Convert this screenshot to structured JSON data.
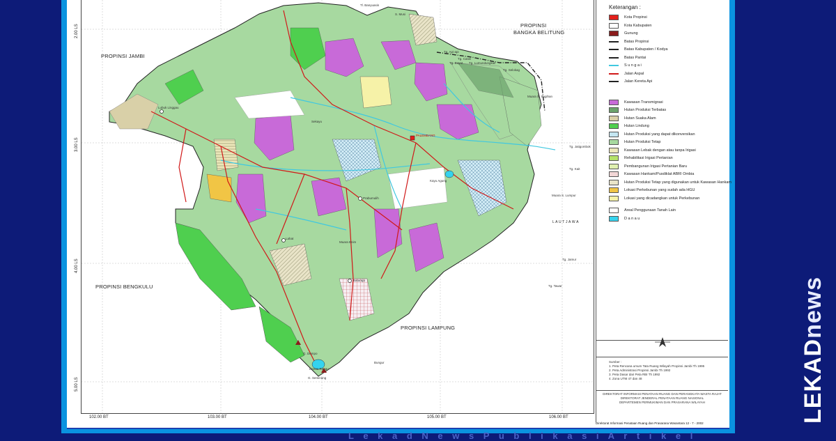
{
  "map": {
    "regions": {
      "jambi": "PROPINSI JAMBI",
      "bangka_1": "PROPINSI",
      "bangka_2": "BANGKA BELITUNG",
      "bengkulu": "PROPINSI BENGKULU",
      "lampung": "PROPINSI LAMPUNG",
      "laut_jawa": "L A U T   J A W A"
    },
    "lat_ticks": [
      "2.00 LS",
      "3.00 LS",
      "4.00 LS",
      "5.00 LS"
    ],
    "lon_ticks": [
      "102.00 BT",
      "103.00 BT",
      "104.00 BT",
      "105.00 BT",
      "106.00 BT"
    ],
    "places": {
      "p1": "Tg. Api-api",
      "p2": "Tg. Carat",
      "p3": "Tg. Buyut",
      "p4": "Tg. Lumundungkuli",
      "p5": "Tg. Selokag",
      "p6": "PALEMBANG",
      "p7": "Muara S. Sugihan",
      "p8": "Tg. Jatigombok",
      "p9": "Tg. Kait",
      "p10": "Muara S. Lumpur",
      "p11": "Tg. Jamur",
      "p12": "Tg. Tawar",
      "p13": "Kayu Agung",
      "p14": "Baturaja",
      "p15": "Bungur",
      "p16": "G. Dempo",
      "p17": "G. Seminung",
      "p18": "Sekayu",
      "p19": "Lahat",
      "p20": "Tl. Banyuasin",
      "p21": "Prabumulih",
      "p22": "Muara Enim",
      "p23": "Lubuk Linggau",
      "p24": "S. Musi",
      "p25": "Danau Ranau"
    }
  },
  "legend": {
    "title": "Keterangan :",
    "items": [
      {
        "label": "Kota Propinsi",
        "color": "#e3201b",
        "icon": "square-marker-icon"
      },
      {
        "label": "Kota Kabupaten",
        "color": "#ffffff",
        "icon": "circle-cross-icon"
      },
      {
        "label": "Gunung",
        "color": "#8b1c1c",
        "icon": "triangle-icon"
      },
      {
        "label": "Batas Propinsi",
        "color": "#222222",
        "icon": "dash-dot-line-icon"
      },
      {
        "label": "Batas Kabupaten / Kodya",
        "color": "#222222",
        "icon": "dash-line-icon"
      },
      {
        "label": "Batas Pantai",
        "color": "#222222",
        "icon": "solid-line-icon"
      },
      {
        "label": "S u n g a i",
        "color": "#40c8e0",
        "icon": "river-icon"
      },
      {
        "label": "Jalan Aspal",
        "color": "#d01818",
        "icon": "road-icon"
      },
      {
        "label": "Jalan Kereta Api",
        "color": "#222222",
        "icon": "railway-icon"
      },
      {
        "label": "Kawasan Transmigrasi",
        "color": "#c86ad8"
      },
      {
        "label": "Hutan Produksi Terbatas",
        "color": "#6ca36c"
      },
      {
        "label": "Hutan Suaka Alam",
        "color": "#d9d0a8"
      },
      {
        "label": "Hutan Lindung",
        "color": "#4fcf4f"
      },
      {
        "label": "Hutan Produksi yang dapat dikonversikan",
        "color": "#c4e6f2"
      },
      {
        "label": "Hutan Produksi Tetap",
        "color": "#a7d9a0"
      },
      {
        "label": "Kawasan Lebak dengan atau tanpa Irigasi",
        "color": "#ece7ba"
      },
      {
        "label": "Rehabilitasi Irigasi Pertanian",
        "color": "#b5e26a"
      },
      {
        "label": "Pembangunan Irigasi Pertanian Baru",
        "color": "#dff0b0"
      },
      {
        "label": "Kawasan Hankam/Pusdiklat ABRI Ombia",
        "color": "#f2d6d6"
      },
      {
        "label": "Hutan Produksi Tetap yang digunakan untuk Kawasan Hankam",
        "color": "#e9e4c8"
      },
      {
        "label": "Lokasi Perkebunan yang sudah ada HGU",
        "color": "#f1c545"
      },
      {
        "label": "Lokasi yang dicadangkan untuk Perkebunan",
        "color": "#f6f2a8"
      },
      {
        "label": "Areal Penggunaan Tanah Lain",
        "color": "#ffffff"
      },
      {
        "label": "D a n a u",
        "color": "#35d3ee"
      }
    ],
    "sources_title": "Sumber :",
    "sources": [
      "1. Peta Rencana umum Tata Ruang Wilayah Propinsi Jambi Th 1995",
      "2. Peta Administrasi Propinsi Jambi Th 1992",
      "3. Peta Dasar dari Peta RBI Th 1992",
      "4. Zona UTM 47 dan 48"
    ],
    "agency": [
      "DIREKTORAT INFORMASI PENATAAN RUANG DAN PERANGKATA WASTA RAJAT",
      "DIREKTORAT JENDERAL PENATAAN RUANG NASIONAL",
      "DEPARTEMEN PERMUKIMAN DAN PRASARANA WILAYAH"
    ],
    "credit": "Direktorat Informasi Penataan Ruang dan Prasarana Wasantara  12 - 7 - 2002"
  },
  "watermark": {
    "brand_bold": "LEKAD",
    "brand_light": "news"
  },
  "bottom_text": "L e k a d  N e w s  P u b l i k a s i  A r t i k e l",
  "colors": {
    "background": "#0d1b78",
    "frame": "#0a93e0",
    "road": "#d01818",
    "river": "#40c8e0",
    "transmigration": "#c86ad8",
    "protected_forest": "#4fcf4f",
    "production_forest": "#a7d9a0"
  }
}
